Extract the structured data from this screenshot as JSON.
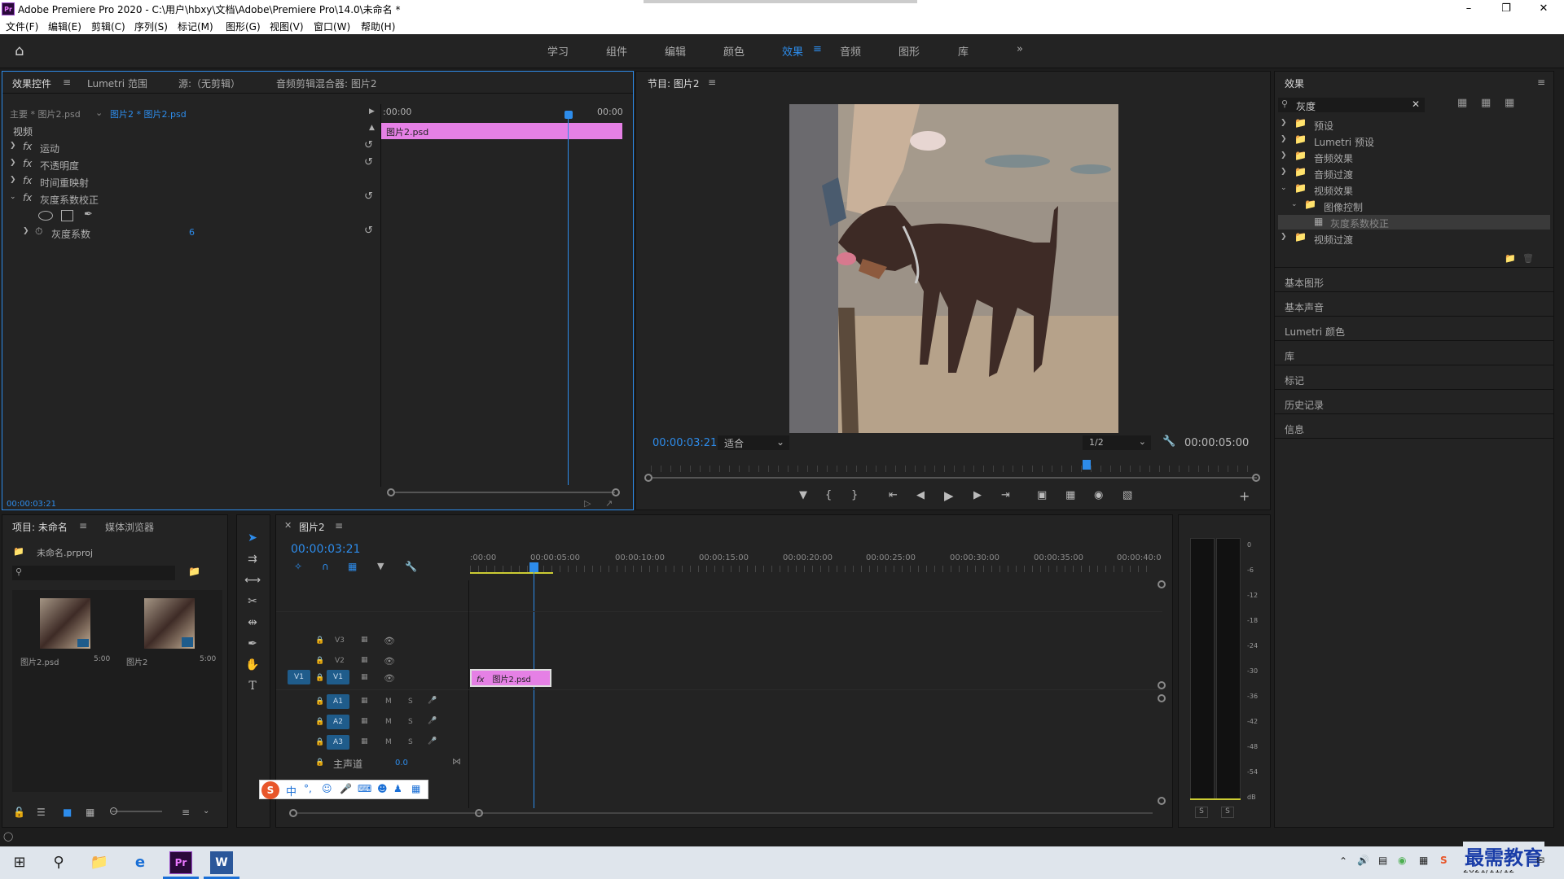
{
  "window": {
    "title": "Adobe Premiere Pro 2020 - C:\\用户\\hbxy\\文档\\Adobe\\Premiere Pro\\14.0\\未命名 *",
    "app_badge": "Pr"
  },
  "menu": [
    "文件(F)",
    "编辑(E)",
    "剪辑(C)",
    "序列(S)",
    "标记(M)",
    "图形(G)",
    "视图(V)",
    "窗口(W)",
    "帮助(H)"
  ],
  "workspaces": [
    "学习",
    "组件",
    "编辑",
    "颜色",
    "效果",
    "音频",
    "图形",
    "库"
  ],
  "active_workspace": "效果",
  "effect_controls": {
    "tabs": [
      "效果控件",
      "Lumetri 范围",
      "源:（无剪辑）",
      "音频剪辑混合器: 图片2"
    ],
    "master": "主要 * 图片2.psd",
    "clip": "图片2 * 图片2.psd",
    "time_start": ":00:00",
    "time_end": "00:00",
    "section": "视频",
    "effects": [
      "运动",
      "不透明度",
      "时间重映射",
      "灰度系数校正"
    ],
    "param_label": "灰度系数",
    "param_value": "6",
    "clip_bar": "图片2.psd",
    "timecode": "00:00:03:21"
  },
  "program": {
    "title": "节目: 图片2",
    "timecode": "00:00:03:21",
    "fit": "适合",
    "resolution": "1/2",
    "duration": "00:00:05:00",
    "playhead_fraction": 0.766
  },
  "effects_panel": {
    "title": "效果",
    "search": "灰度",
    "tree": [
      {
        "label": "预设",
        "level": 0
      },
      {
        "label": "Lumetri 预设",
        "level": 0
      },
      {
        "label": "音频效果",
        "level": 0
      },
      {
        "label": "音频过渡",
        "level": 0
      },
      {
        "label": "视频效果",
        "level": 0
      },
      {
        "label": "图像控制",
        "level": 1
      },
      {
        "label": "灰度系数校正",
        "level": 2
      },
      {
        "label": "视频过渡",
        "level": 0
      }
    ],
    "side_panels": [
      "基本图形",
      "基本声音",
      "Lumetri 颜色",
      "库",
      "标记",
      "历史记录",
      "信息"
    ]
  },
  "project": {
    "tabs": [
      "项目: 未命名",
      "媒体浏览器"
    ],
    "file": "未命名.prproj",
    "items": [
      {
        "name": "图片2.psd",
        "duration": "5:00"
      },
      {
        "name": "图片2",
        "duration": "5:00"
      }
    ]
  },
  "timeline": {
    "tab": "图片2",
    "timecode": "00:00:03:21",
    "ruler": [
      ":00:00",
      "00:00:05:00",
      "00:00:10:00",
      "00:00:15:00",
      "00:00:20:00",
      "00:00:25:00",
      "00:00:30:00",
      "00:00:35:00",
      "00:00:40:0"
    ],
    "video_tracks": [
      "V3",
      "V2",
      "V1"
    ],
    "audio_tracks": [
      "A1",
      "A2",
      "A3"
    ],
    "src_v1": "V1",
    "master": "主声道",
    "master_value": "0.0",
    "clip": "图片2.psd",
    "clip_badge": "fx",
    "m_label": "M",
    "s_label": "S"
  },
  "meter": {
    "scale": [
      "0",
      "-6",
      "-12",
      "-18",
      "-24",
      "-30",
      "-36",
      "-42",
      "-48",
      "-54",
      "dB"
    ],
    "solo": [
      "S",
      "S"
    ]
  },
  "ime": {
    "text": "中"
  },
  "taskbar": {
    "date": "2021/11/12",
    "watermark": "最需教育"
  }
}
